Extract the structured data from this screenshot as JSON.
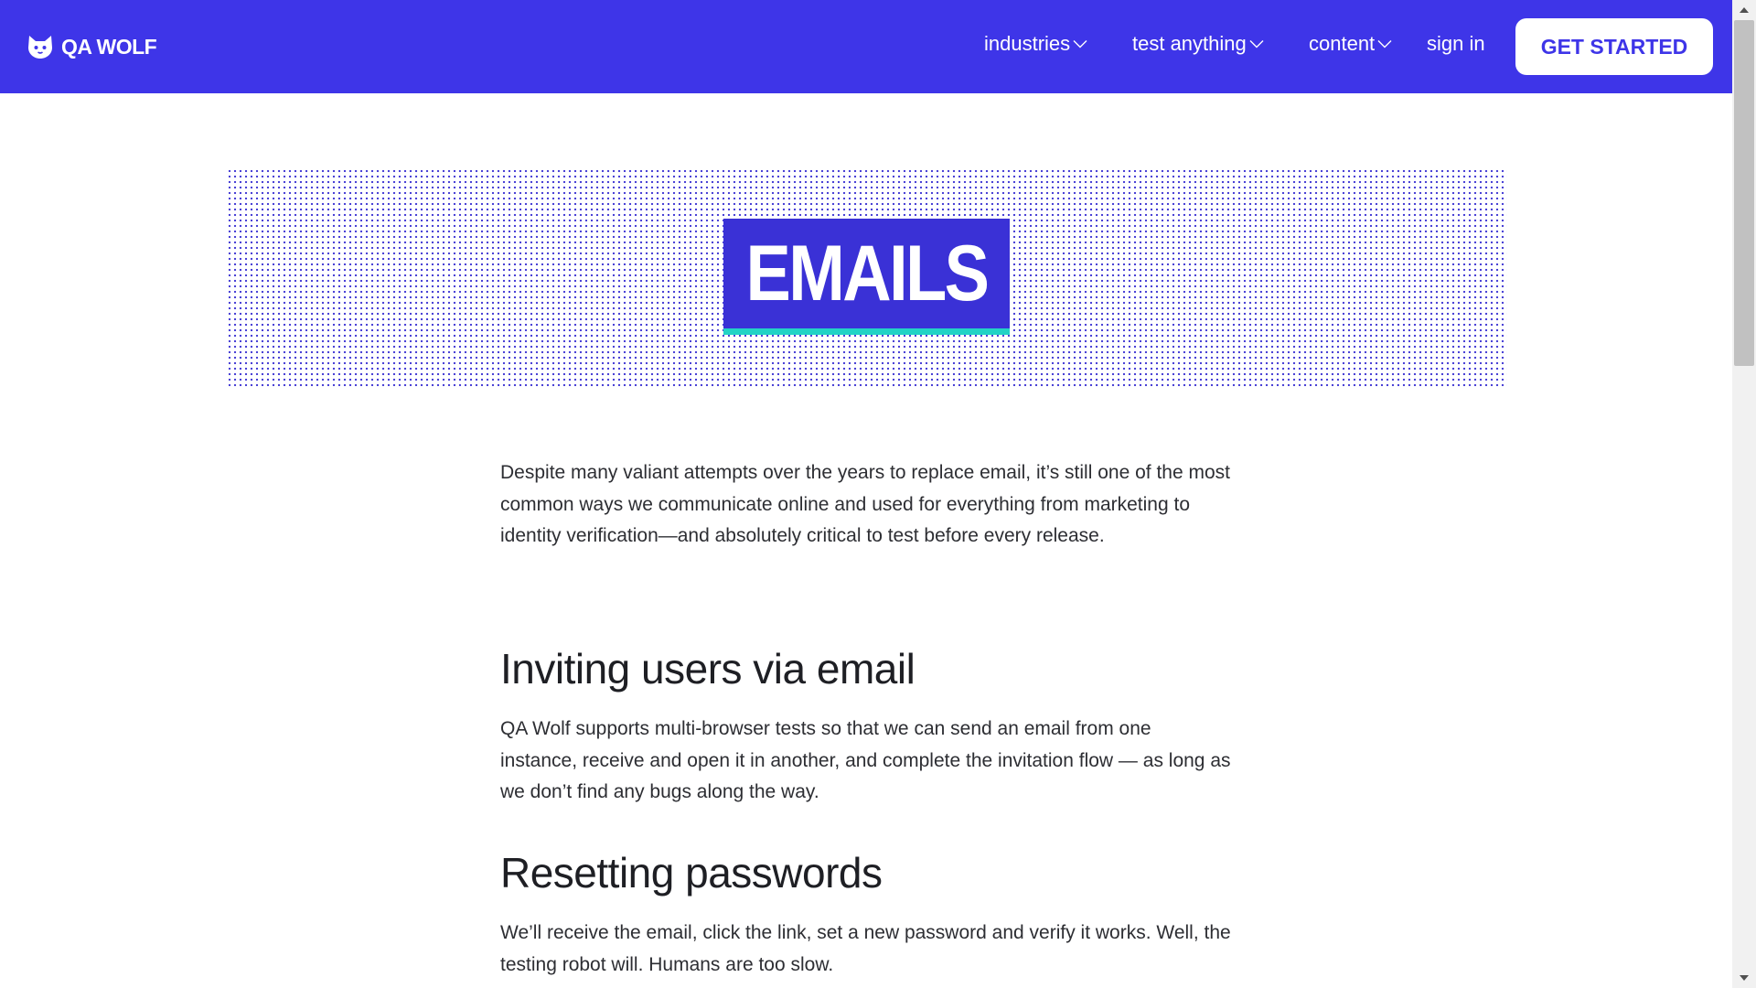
{
  "brand": {
    "logo_text": "QA WOLF",
    "colors": {
      "primary": "#3e35e8",
      "hero_box": "#3a31d6",
      "accent": "#22d3c5",
      "dots": "#4a42d6"
    }
  },
  "nav": {
    "items": [
      {
        "label": "industries",
        "has_dropdown": true
      },
      {
        "label": "test anything",
        "has_dropdown": true
      },
      {
        "label": "content",
        "has_dropdown": true
      },
      {
        "label": "sign in",
        "has_dropdown": false
      }
    ],
    "cta_label": "GET STARTED"
  },
  "hero": {
    "title": "EMAILS"
  },
  "article": {
    "intro": "Despite many valiant attempts over the years to replace email, it’s still one of the most common ways we communicate online and used for everything from marketing to identity verification—and absolutely critical to test before every release.",
    "sections": [
      {
        "heading": "Inviting users via email",
        "body": "QA Wolf supports multi-browser tests so that we can send an email from one instance, receive and open it in another, and complete the invitation flow — as long as we don’t find any bugs along the way."
      },
      {
        "heading": "Resetting passwords",
        "body": "We’ll receive the email, click the link, set a new password and verify it works. Well, the testing robot will. Humans are too slow."
      }
    ]
  },
  "icons": {
    "logo": "wolf-logo-icon",
    "dropdown": "chevron-down-icon",
    "scroll_up": "scroll-up-arrow-icon",
    "scroll_down": "scroll-down-arrow-icon"
  }
}
